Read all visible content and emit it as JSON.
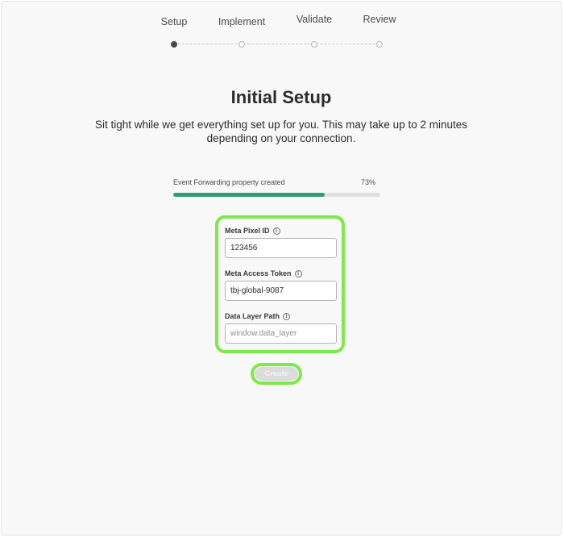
{
  "stepper": {
    "steps": [
      {
        "label": "Setup",
        "state": "active"
      },
      {
        "label": "Implement",
        "state": "inactive"
      },
      {
        "label": "Validate",
        "state": "inactive"
      },
      {
        "label": "Review",
        "state": "inactive"
      }
    ]
  },
  "header": {
    "title": "Initial Setup",
    "subtitle": "Sit tight while we get everything set up for you. This may take up to 2 minutes depending on your connection."
  },
  "progress": {
    "label": "Event Forwarding property created",
    "value_text": "73%",
    "value": 0.73,
    "color": "#2d9d78"
  },
  "form": {
    "fields": [
      {
        "label": "Meta Pixel ID",
        "value": "123456",
        "placeholder": "",
        "info_icon": "info-icon"
      },
      {
        "label": "Meta Access Token",
        "value": "tbj-global-9087",
        "placeholder": "",
        "info_icon": "info-icon"
      },
      {
        "label": "Data Layer Path",
        "value": "",
        "placeholder": "window.data_layer",
        "info_icon": "info-icon"
      }
    ],
    "create_label": "Create",
    "highlight_color": "#7cea47"
  }
}
